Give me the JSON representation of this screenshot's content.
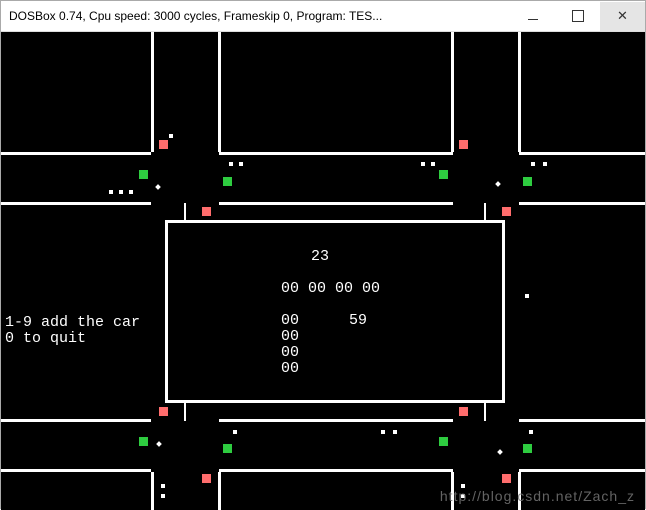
{
  "window": {
    "title": "DOSBox 0.74, Cpu speed:    3000 cycles, Frameskip  0, Program:   TES..."
  },
  "help": {
    "line1": "1-9 add the car",
    "line2": "0 to quit"
  },
  "center": {
    "top_value": "23",
    "row1": "00 00 00 00",
    "col_value1": "00",
    "col_value2": "00",
    "col_value3": "00",
    "col_value4": "00",
    "right_value": "59"
  },
  "watermark": "http://blog.csdn.net/Zach_z"
}
